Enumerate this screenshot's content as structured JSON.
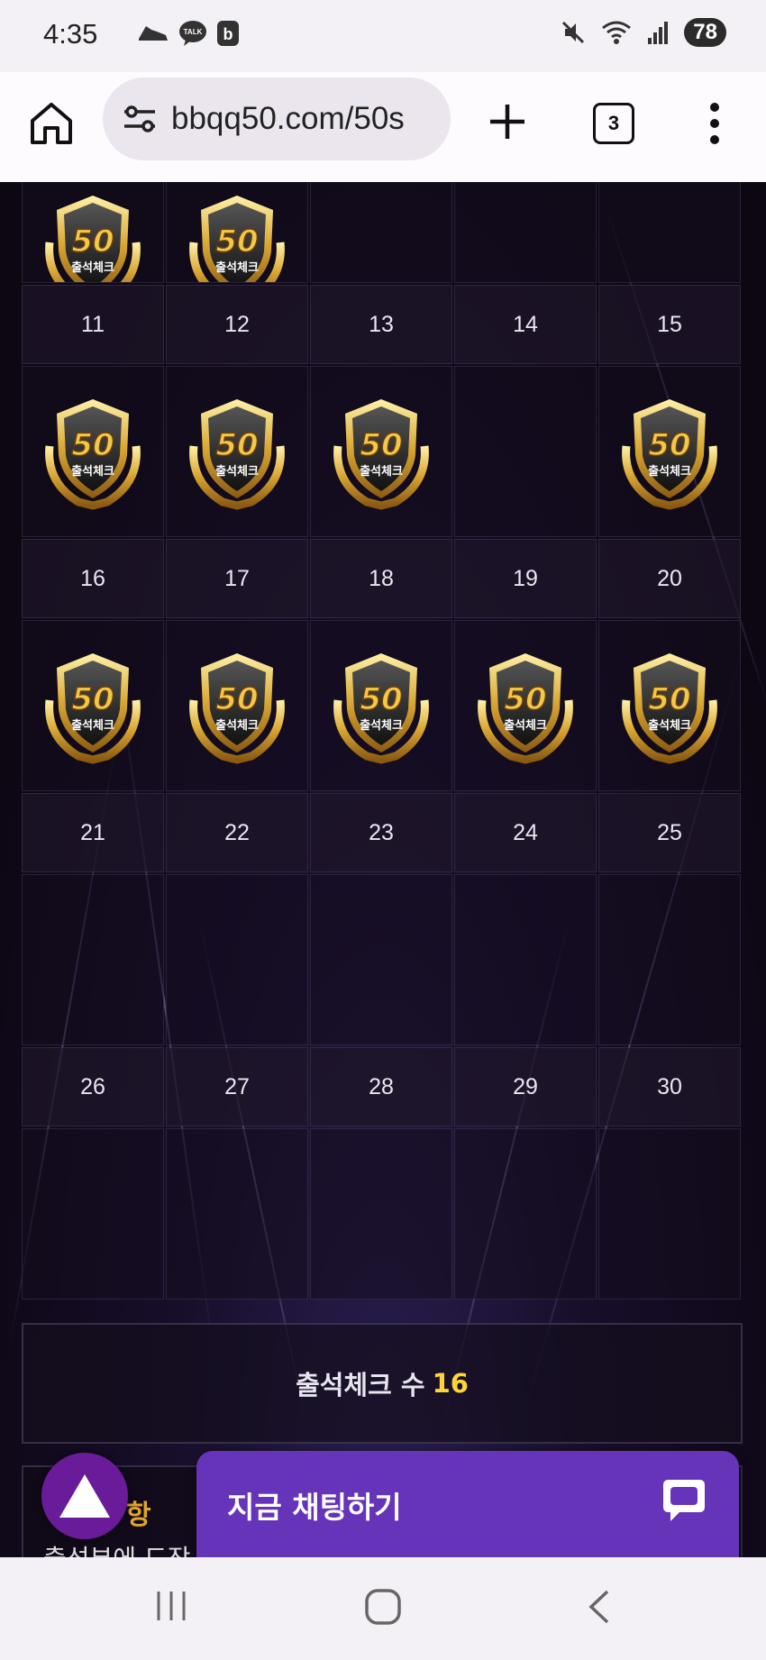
{
  "status_bar": {
    "time": "4:35",
    "left_icons": [
      "shoe-icon",
      "kakaotalk-icon",
      "blog-b-icon"
    ],
    "right_icons": [
      "mute-icon",
      "wifi-icon",
      "signal-icon"
    ],
    "battery": "78",
    "talk_label": "TALK"
  },
  "browser": {
    "url": "bbqq50.com/50s",
    "tab_count": "3"
  },
  "calendar": {
    "badge_label": "출석체크",
    "badge_number": "50",
    "top_row_checked": [
      true,
      true,
      false,
      false,
      false
    ],
    "weeks": [
      {
        "days": [
          "11",
          "12",
          "13",
          "14",
          "15"
        ],
        "checked": [
          true,
          true,
          true,
          false,
          true
        ]
      },
      {
        "days": [
          "16",
          "17",
          "18",
          "19",
          "20"
        ],
        "checked": [
          true,
          true,
          true,
          true,
          true
        ]
      },
      {
        "days": [
          "21",
          "22",
          "23",
          "24",
          "25"
        ],
        "checked": [
          false,
          false,
          false,
          false,
          false
        ]
      },
      {
        "days": [
          "26",
          "27",
          "28",
          "29",
          "30"
        ],
        "checked": [
          false,
          false,
          false,
          false,
          false
        ]
      }
    ]
  },
  "attendance": {
    "label": "출석체크 수",
    "count": "16"
  },
  "notice": {
    "title_visible": "항",
    "text_visible": "출석부에 도장"
  },
  "chat": {
    "label": "지금 채팅하기"
  },
  "colors": {
    "chat_purple": "#6534b8",
    "up_button_purple": "#6a1b9a",
    "count_yellow": "#ffd43b",
    "notice_orange": "#e2a42b"
  }
}
